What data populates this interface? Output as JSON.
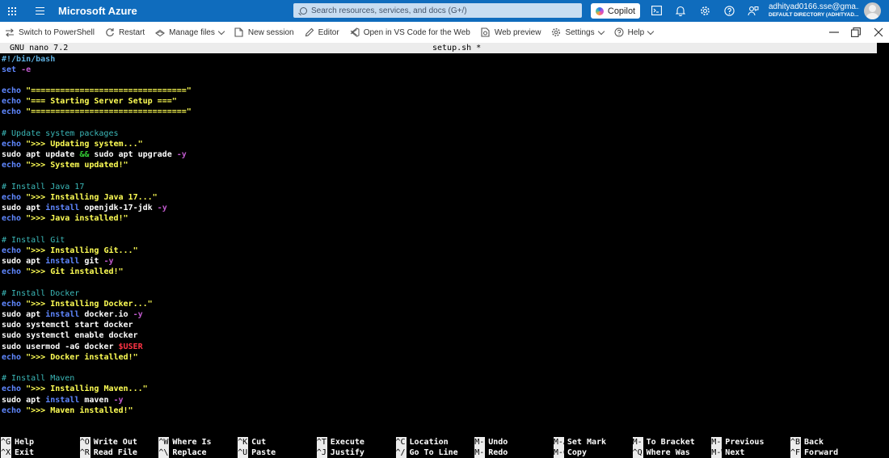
{
  "topbar": {
    "brand": "Microsoft Azure",
    "search_placeholder": "Search resources, services, and docs (G+/)",
    "copilot_label": "Copilot",
    "account_email": "adhityad0166.sse@gma...",
    "account_directory": "DEFAULT DIRECTORY (ADHITYAD..."
  },
  "toolbar": {
    "items": [
      {
        "label": "Switch to PowerShell",
        "icon": "switch-icon"
      },
      {
        "label": "Restart",
        "icon": "restart-icon"
      },
      {
        "label": "Manage files",
        "icon": "manage-files-icon",
        "dropdown": true
      },
      {
        "label": "New session",
        "icon": "new-session-icon"
      },
      {
        "label": "Editor",
        "icon": "editor-icon"
      },
      {
        "label": "Open in VS Code for the Web",
        "icon": "vscode-icon"
      },
      {
        "label": "Web preview",
        "icon": "web-preview-icon"
      },
      {
        "label": "Settings",
        "icon": "gear-icon",
        "dropdown": true
      },
      {
        "label": "Help",
        "icon": "help-icon",
        "dropdown": true
      }
    ]
  },
  "editor": {
    "version": "GNU nano 7.2",
    "filename": "setup.sh *",
    "lines": [
      [
        [
          "shebang",
          "#!/bin/bash"
        ]
      ],
      [
        [
          "kw",
          "set"
        ],
        [
          "plain",
          " "
        ],
        [
          "flag",
          "-e"
        ],
        [
          "cursor",
          " "
        ]
      ],
      [],
      [
        [
          "kw",
          "echo"
        ],
        [
          "plain",
          " "
        ],
        [
          "str",
          "\"================================\""
        ]
      ],
      [
        [
          "kw",
          "echo"
        ],
        [
          "plain",
          " "
        ],
        [
          "str",
          "\"=== Starting Server Setup ===\""
        ]
      ],
      [
        [
          "kw",
          "echo"
        ],
        [
          "plain",
          " "
        ],
        [
          "str",
          "\"================================\""
        ]
      ],
      [],
      [
        [
          "comment",
          "# Update system packages"
        ]
      ],
      [
        [
          "kw",
          "echo"
        ],
        [
          "plain",
          " "
        ],
        [
          "str",
          "\">>> Updating system...\""
        ]
      ],
      [
        [
          "plain",
          "sudo apt update "
        ],
        [
          "op",
          "&&"
        ],
        [
          "plain",
          " sudo apt upgrade "
        ],
        [
          "flag",
          "-y"
        ]
      ],
      [
        [
          "kw",
          "echo"
        ],
        [
          "plain",
          " "
        ],
        [
          "str",
          "\">>> System updated!\""
        ]
      ],
      [],
      [
        [
          "comment",
          "# Install Java 17"
        ]
      ],
      [
        [
          "kw",
          "echo"
        ],
        [
          "plain",
          " "
        ],
        [
          "str",
          "\">>> Installing Java 17...\""
        ]
      ],
      [
        [
          "plain",
          "sudo apt "
        ],
        [
          "kw",
          "install"
        ],
        [
          "plain",
          " openjdk-17-jdk "
        ],
        [
          "flag",
          "-y"
        ]
      ],
      [
        [
          "kw",
          "echo"
        ],
        [
          "plain",
          " "
        ],
        [
          "str",
          "\">>> Java installed!\""
        ]
      ],
      [],
      [
        [
          "comment",
          "# Install Git"
        ]
      ],
      [
        [
          "kw",
          "echo"
        ],
        [
          "plain",
          " "
        ],
        [
          "str",
          "\">>> Installing Git...\""
        ]
      ],
      [
        [
          "plain",
          "sudo apt "
        ],
        [
          "kw",
          "install"
        ],
        [
          "plain",
          " git "
        ],
        [
          "flag",
          "-y"
        ]
      ],
      [
        [
          "kw",
          "echo"
        ],
        [
          "plain",
          " "
        ],
        [
          "str",
          "\">>> Git installed!\""
        ]
      ],
      [],
      [
        [
          "comment",
          "# Install Docker"
        ]
      ],
      [
        [
          "kw",
          "echo"
        ],
        [
          "plain",
          " "
        ],
        [
          "str",
          "\">>> Installing Docker...\""
        ]
      ],
      [
        [
          "plain",
          "sudo apt "
        ],
        [
          "kw",
          "install"
        ],
        [
          "plain",
          " docker.io "
        ],
        [
          "flag",
          "-y"
        ]
      ],
      [
        [
          "plain",
          "sudo systemctl start docker"
        ]
      ],
      [
        [
          "plain",
          "sudo systemctl enable docker"
        ]
      ],
      [
        [
          "plain",
          "sudo usermod -aG docker "
        ],
        [
          "var",
          "$USER"
        ]
      ],
      [
        [
          "kw",
          "echo"
        ],
        [
          "plain",
          " "
        ],
        [
          "str",
          "\">>> Docker installed!\""
        ]
      ],
      [],
      [
        [
          "comment",
          "# Install Maven"
        ]
      ],
      [
        [
          "kw",
          "echo"
        ],
        [
          "plain",
          " "
        ],
        [
          "str",
          "\">>> Installing Maven...\""
        ]
      ],
      [
        [
          "plain",
          "sudo apt "
        ],
        [
          "kw",
          "install"
        ],
        [
          "plain",
          " maven "
        ],
        [
          "flag",
          "-y"
        ]
      ],
      [
        [
          "kw",
          "echo"
        ],
        [
          "plain",
          " "
        ],
        [
          "str",
          "\">>> Maven installed!\""
        ]
      ]
    ],
    "shortcuts": [
      [
        {
          "key": "^G",
          "label": "Help"
        },
        {
          "key": "^X",
          "label": "Exit"
        }
      ],
      [
        {
          "key": "^O",
          "label": "Write Out"
        },
        {
          "key": "^R",
          "label": "Read File"
        }
      ],
      [
        {
          "key": "^W",
          "label": "Where Is"
        },
        {
          "key": "^\\",
          "label": "Replace"
        }
      ],
      [
        {
          "key": "^K",
          "label": "Cut"
        },
        {
          "key": "^U",
          "label": "Paste"
        }
      ],
      [
        {
          "key": "^T",
          "label": "Execute"
        },
        {
          "key": "^J",
          "label": "Justify"
        }
      ],
      [
        {
          "key": "^C",
          "label": "Location"
        },
        {
          "key": "^/",
          "label": "Go To Line"
        }
      ],
      [
        {
          "key": "M-U",
          "label": "Undo"
        },
        {
          "key": "M-E",
          "label": "Redo"
        }
      ],
      [
        {
          "key": "M-A",
          "label": "Set Mark"
        },
        {
          "key": "M-6",
          "label": "Copy"
        }
      ],
      [
        {
          "key": "M-]",
          "label": "To Bracket"
        },
        {
          "key": "^Q",
          "label": "Where Was"
        }
      ],
      [
        {
          "key": "M-Q",
          "label": "Previous"
        },
        {
          "key": "M-W",
          "label": "Next"
        }
      ],
      [
        {
          "key": "^B",
          "label": "Back"
        },
        {
          "key": "^F",
          "label": "Forward"
        }
      ]
    ]
  }
}
